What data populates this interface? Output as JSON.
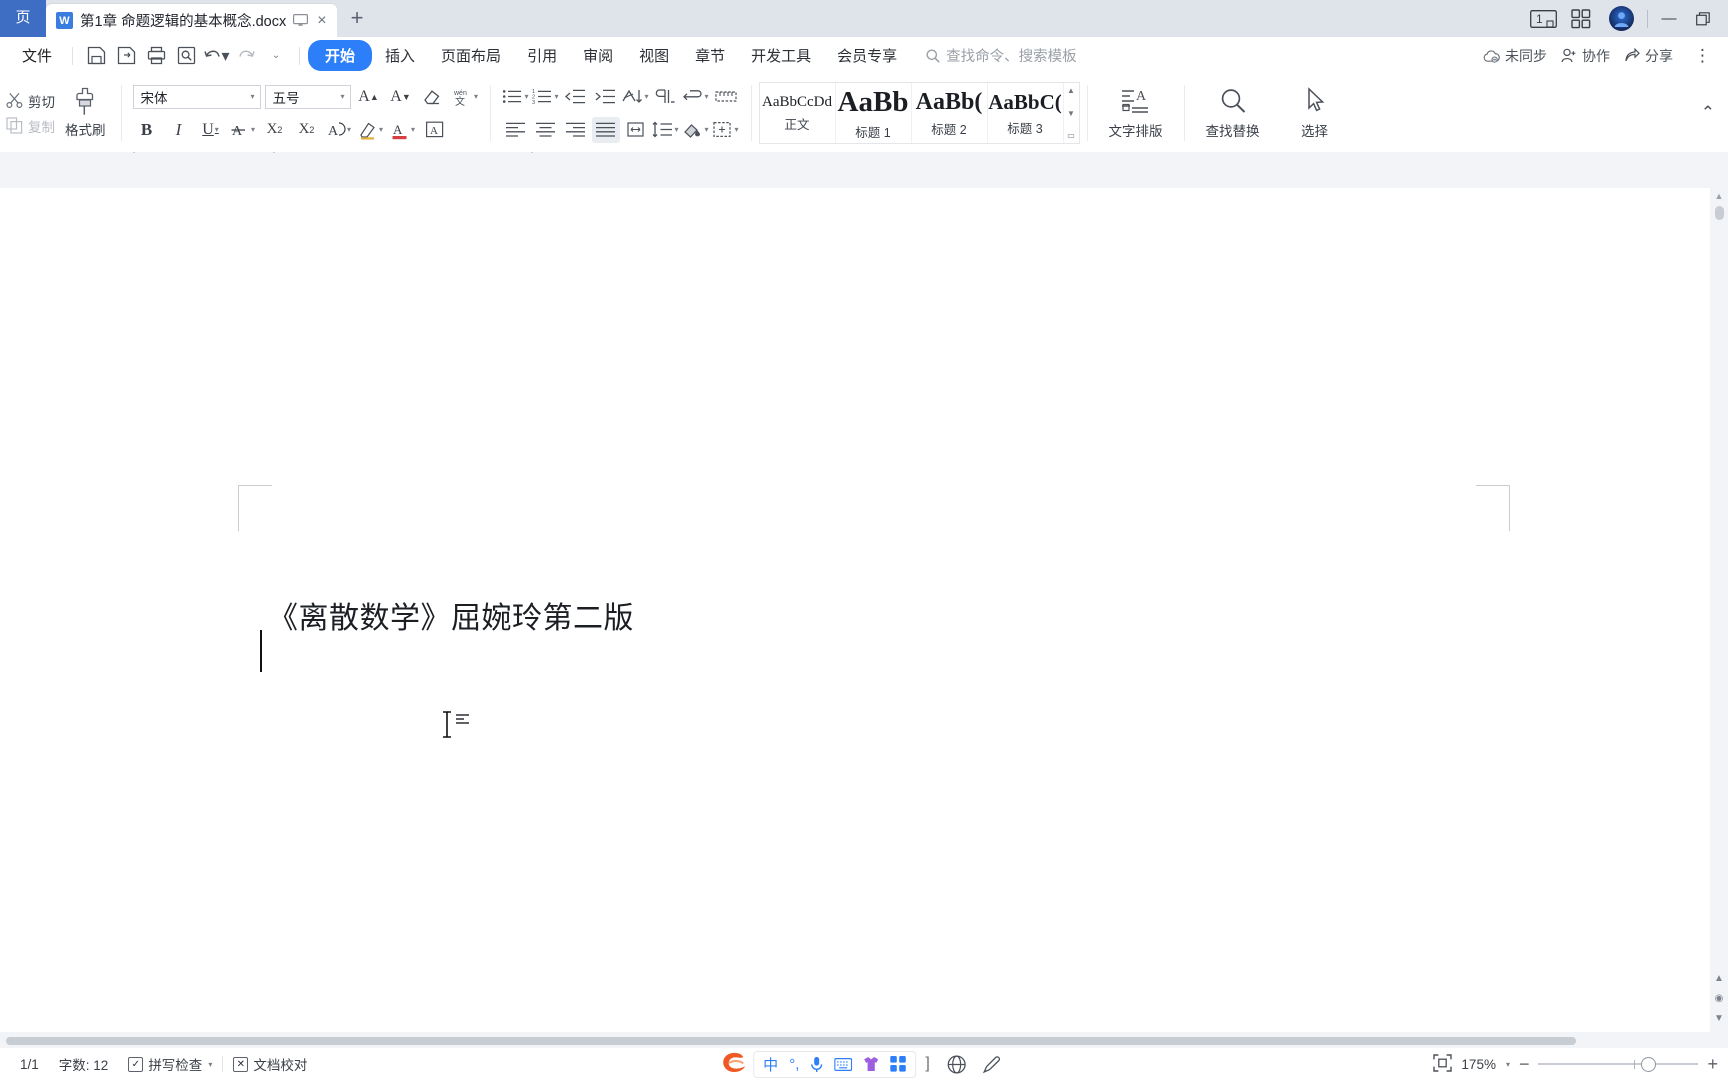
{
  "titlebar": {
    "home_label": "页",
    "tab": {
      "app_initial": "W",
      "title": "第1章 命题逻辑的基本概念.docx",
      "monitor_icon": "monitor-icon",
      "close_icon": "×"
    },
    "new_tab": "+",
    "page_count_badge": "1",
    "apps_icon": "grid-apps-icon",
    "avatar": "user-avatar",
    "minimize": "—",
    "maximize": "▢"
  },
  "menubar": {
    "file": "文件",
    "quick_access": [
      "save-icon",
      "save-as-icon",
      "print-icon",
      "print-preview-icon",
      "undo-icon",
      "redo-icon",
      "customize-icon"
    ],
    "items": [
      {
        "label": "开始",
        "active": true
      },
      {
        "label": "插入",
        "active": false
      },
      {
        "label": "页面布局",
        "active": false
      },
      {
        "label": "引用",
        "active": false
      },
      {
        "label": "审阅",
        "active": false
      },
      {
        "label": "视图",
        "active": false
      },
      {
        "label": "章节",
        "active": false
      },
      {
        "label": "开发工具",
        "active": false
      },
      {
        "label": "会员专享",
        "active": false
      }
    ],
    "search_placeholder": "查找命令、搜索模板",
    "sync_status": "未同步",
    "collaborate": "协作",
    "share": "分享",
    "more": "⋮"
  },
  "ribbon": {
    "clipboard": {
      "cut": "剪切",
      "copy": "复制",
      "format_painter": "格式刷"
    },
    "font": {
      "family_value": "宋体",
      "size_value": "五号",
      "grow_icon": "A⁺",
      "shrink_icon": "A⁻",
      "clear_format_icon": "clear-format-icon",
      "pinyin_icon": "拼",
      "bold": "B",
      "italic": "I",
      "underline": "U",
      "strike_icon": "A-strikethrough-icon",
      "superscript": "X",
      "subscript": "X",
      "char_border_icon": "A-border-icon",
      "highlight_icon": "highlight-icon",
      "font_color_icon": "A-color-icon",
      "text_effect_icon": "A-box-icon"
    },
    "paragraph": {
      "bullets_icon": "bullet-list-icon",
      "numbering_icon": "numbered-list-icon",
      "decrease_indent_icon": "decrease-indent-icon",
      "increase_indent_icon": "increase-indent-icon",
      "sort_icon": "sort-icon",
      "show_marks_icon": "paragraph-marks-icon",
      "align_left_icon": "align-left-icon",
      "align_center_icon": "align-center-icon",
      "align_right_icon": "align-right-icon",
      "align_justify_icon": "align-justify-icon",
      "distribute_icon": "distribute-icon",
      "line_spacing_icon": "line-spacing-icon",
      "shading_icon": "shading-icon",
      "borders_icon": "borders-icon",
      "asian_layout_icon": "asian-layout-icon",
      "ruler_icon": "ruler-icon"
    },
    "styles": [
      {
        "preview": "AaBbCcDd",
        "name": "正文",
        "size": 15
      },
      {
        "preview": "AaBb",
        "name": "标题 1",
        "size": 29
      },
      {
        "preview": "AaBb(",
        "name": "标题 2",
        "size": 24
      },
      {
        "preview": "AaBbC(",
        "name": "标题 3",
        "size": 21
      }
    ],
    "text_layout": "文字排版",
    "find_replace": "查找替换",
    "select": "选择"
  },
  "document": {
    "body_text": "《离散数学》屈婉玲第二版",
    "zoom_label": "175%"
  },
  "statusbar": {
    "page_indicator": "1/1",
    "word_count": "字数: 12",
    "spell_check": "拼写检查",
    "doc_proofread": "文档校对",
    "ime": {
      "logo": "S",
      "mode": "中",
      "punctuation": "°,",
      "mic_icon": "microphone-icon",
      "keyboard_icon": "keyboard-icon",
      "skin_icon": "skin-icon",
      "apps_icon": "ime-apps-icon"
    },
    "web_layout_icon": "web-layout-icon",
    "pen_icon": "pen-icon",
    "fit_page_icon": "fit-page-icon",
    "zoom_value": "175%",
    "zoom_out": "−",
    "zoom_in": "+"
  },
  "colors": {
    "accent": "#2d7ff9",
    "titlebar_bg": "#dfe3ea",
    "home_tab_bg": "#3d6ec4",
    "page_bg": "#ffffff",
    "canvas_bg": "#f2f4f7"
  }
}
